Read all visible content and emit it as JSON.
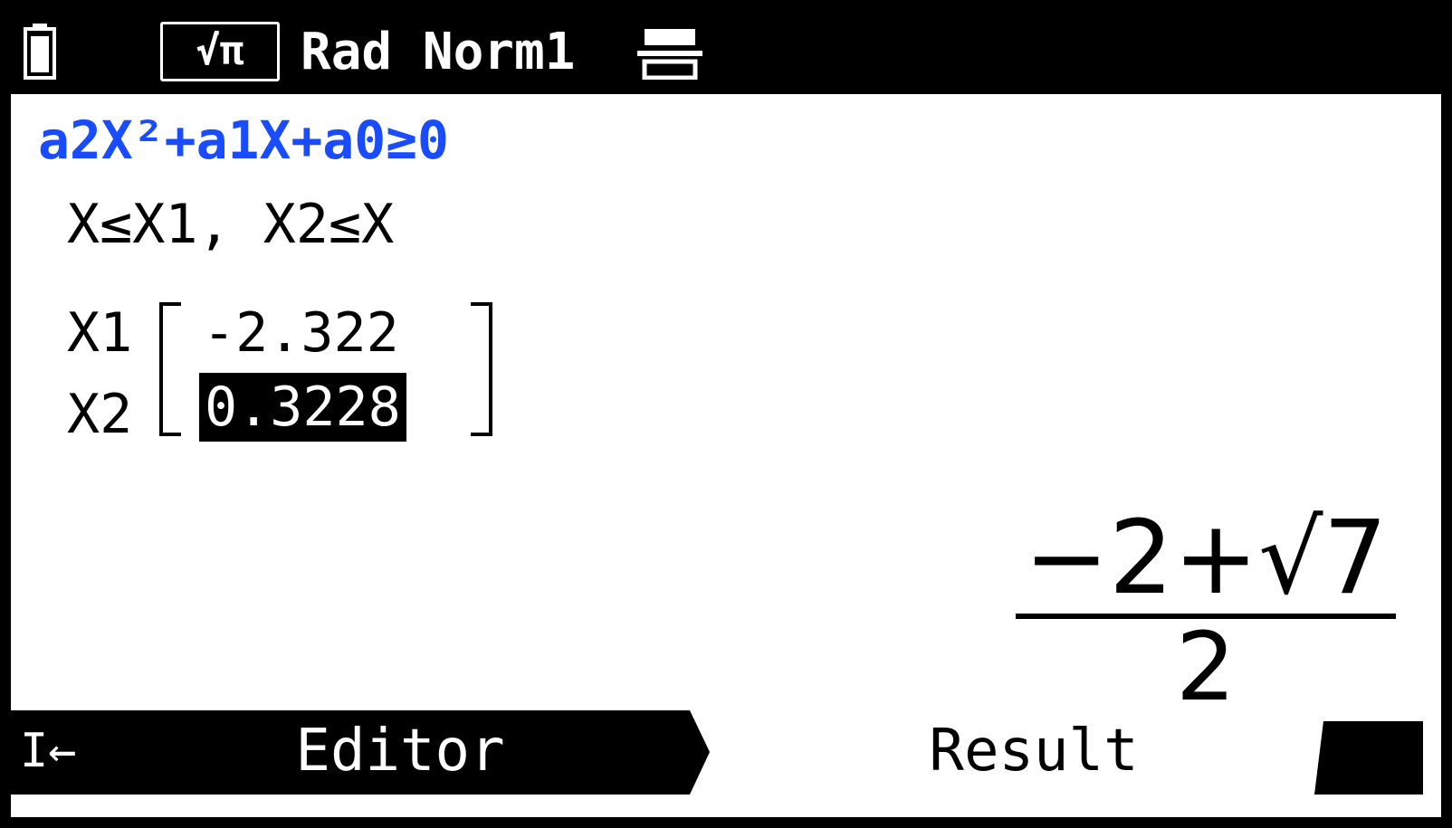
{
  "status": {
    "mode_label": "√π",
    "status_text": "Rad Norm1"
  },
  "equation": "a2X²+a1X+a0≥0",
  "condition": "X≤X1, X2≤X",
  "solutions": {
    "labels": [
      "X1",
      "X2"
    ],
    "values": [
      "-2.322",
      "0.3228"
    ],
    "selected_index": 1
  },
  "result": {
    "numerator": "−2+√7",
    "denominator": "2"
  },
  "bottom_tabs": {
    "back_label": "I←",
    "editor_label": "Editor",
    "result_label": "Result"
  }
}
